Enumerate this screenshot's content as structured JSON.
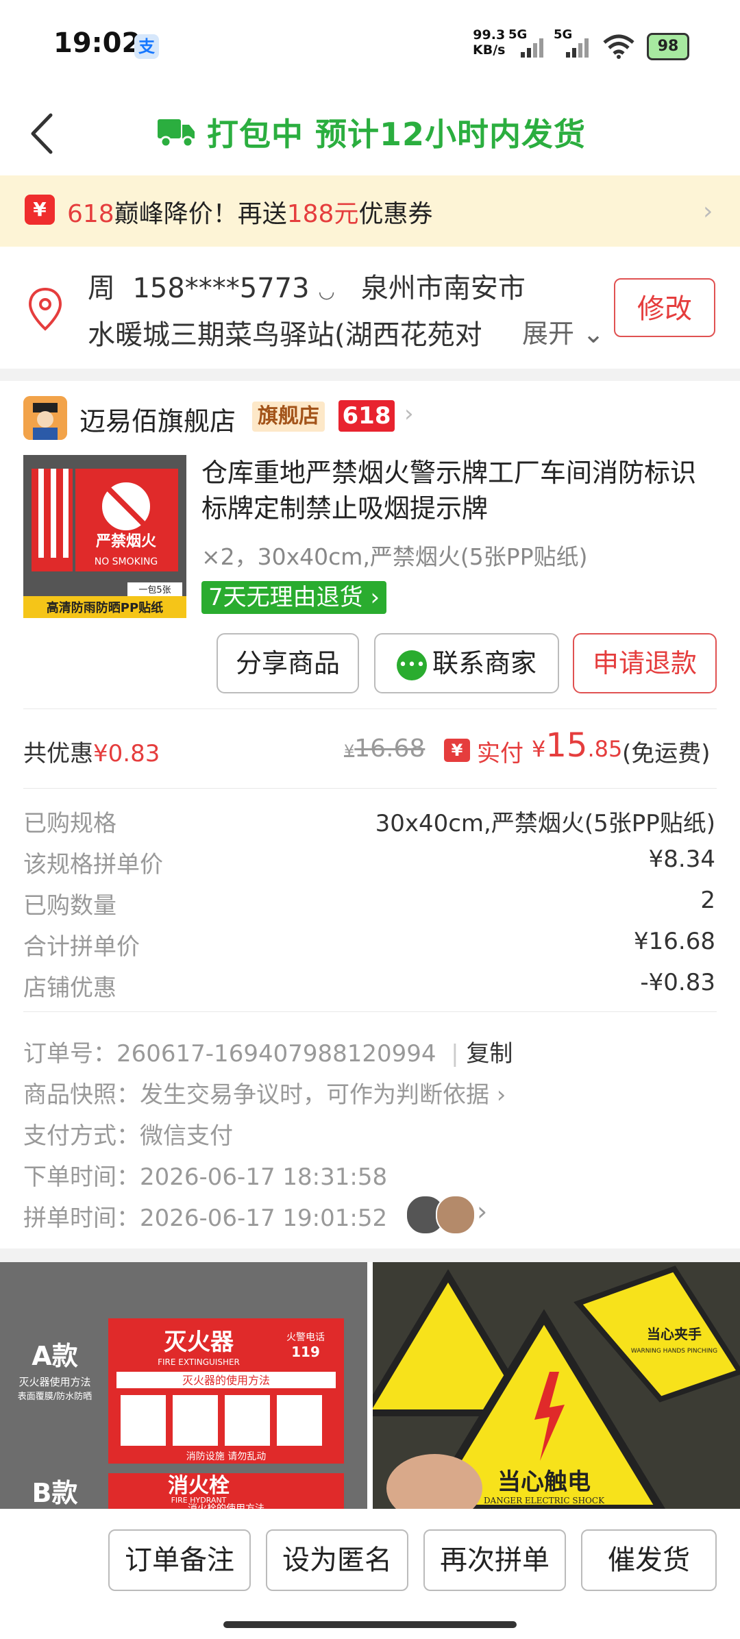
{
  "status_bar": {
    "time": "19:02",
    "speed": "99.3",
    "speed_unit": "KB/s",
    "sig1": "5G",
    "sig2": "5G",
    "battery": "98"
  },
  "nav": {
    "title": "打包中 预计12小时内发货"
  },
  "promo": {
    "icon": "¥",
    "prefix": "618",
    "t1": "巅峰降价！再送",
    "amount": "188元",
    "t2": "优惠券"
  },
  "address": {
    "name": "周",
    "phone": "158****5773",
    "city": "泉州市南安市",
    "detail": "水暖城三期菜鸟驿站(湖西花苑对",
    "expand": "展开",
    "edit": "修改"
  },
  "store": {
    "name": "迈易佰旗舰店",
    "flag": "旗舰店",
    "badge618": "618"
  },
  "product": {
    "title": "仓库重地严禁烟火警示牌工厂车间消防标识标牌定制禁止吸烟提示牌",
    "spec": "×2，30x40cm,严禁烟火(5张PP贴纸)",
    "return_badge": "7天无理由退货",
    "img_text1": "严禁烟火",
    "img_text2": "NO SMOKING",
    "img_text3": "一包5张",
    "img_text4": "高清防雨防晒PP贴纸",
    "btn_share": "分享商品",
    "btn_contact": "联系商家",
    "btn_refund": "申请退款"
  },
  "price": {
    "discount_label": "共优惠",
    "discount_value": "¥0.83",
    "orig": "16.68",
    "paid_label": "实付",
    "paid_int": "15",
    "paid_dec": ".85",
    "free_ship": "(免运费)"
  },
  "details": [
    {
      "label": "已购规格",
      "value": "30x40cm,严禁烟火(5张PP贴纸)"
    },
    {
      "label": "该规格拼单价",
      "value": "¥8.34"
    },
    {
      "label": "已购数量",
      "value": "2"
    },
    {
      "label": "合计拼单价",
      "value": "¥16.68"
    },
    {
      "label": "店铺优惠",
      "value": "-¥0.83"
    }
  ],
  "order": {
    "no_label": "订单号：",
    "no_value": "260617-169407988120994",
    "copy": "复制",
    "snapshot_label": "商品快照：",
    "snapshot_value": "发生交易争议时，可作为判断依据",
    "pay_label": "支付方式：",
    "pay_value": "微信支付",
    "order_time_label": "下单时间：",
    "order_time_value": "2026-06-17 18:31:58",
    "group_time_label": "拼单时间：",
    "group_time_value": "2026-06-17 19:01:52"
  },
  "ads": {
    "left_a": "A款",
    "left_a_sub": "灭火器使用方法",
    "left_a_sub2": "表面覆膜/防水防晒",
    "left_title": "灭火器",
    "left_title_en": "FIRE EXTINGUISHER",
    "left_phone": "火警电话",
    "left_119": "119",
    "left_method": "灭火器的使用方法",
    "left_foot": "消防设施    请勿乱动",
    "left_b": "B款",
    "left_b_title": "消火栓",
    "left_b_en": "FIRE HYDRANT",
    "left_b_method": "消火栓的使用方法",
    "right_main": "当心触电",
    "right_main_en": "DANGER ELECTRIC SHOCK",
    "right_sub": "当心夹手",
    "right_sub_en": "WARNING HANDS PINCHING"
  },
  "bottom": {
    "note": "订单备注",
    "anon": "设为匿名",
    "again": "再次拼单",
    "urge": "催发货"
  }
}
